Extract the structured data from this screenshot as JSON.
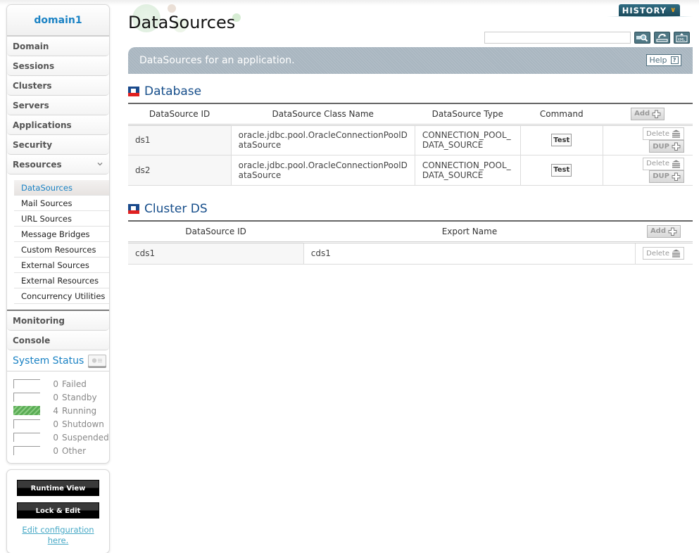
{
  "sidebar": {
    "domain": "domain1",
    "nav": [
      {
        "label": "Domain"
      },
      {
        "label": "Sessions"
      },
      {
        "label": "Clusters"
      },
      {
        "label": "Servers"
      },
      {
        "label": "Applications"
      },
      {
        "label": "Security"
      },
      {
        "label": "Resources",
        "expanded": true
      }
    ],
    "resources_sub": [
      {
        "label": "DataSources",
        "active": true
      },
      {
        "label": "Mail Sources"
      },
      {
        "label": "URL Sources"
      },
      {
        "label": "Message Bridges"
      },
      {
        "label": "Custom Resources"
      },
      {
        "label": "External Sources"
      },
      {
        "label": "External Resources"
      },
      {
        "label": "Concurrency Utilities"
      }
    ],
    "nav_after": [
      {
        "label": "Monitoring"
      },
      {
        "label": "Console"
      }
    ],
    "system_status": {
      "title": "System Status",
      "items": [
        {
          "count": "0",
          "label": "Failed"
        },
        {
          "count": "0",
          "label": "Standby"
        },
        {
          "count": "4",
          "label": "Running"
        },
        {
          "count": "0",
          "label": "Shutdown"
        },
        {
          "count": "0",
          "label": "Suspended"
        },
        {
          "count": "0",
          "label": "Other"
        }
      ],
      "running_color": "#5aad55"
    },
    "actions": {
      "runtime_view": "Runtime View",
      "lock_edit": "Lock & Edit",
      "edit_link_line1": "Edit configuration",
      "edit_link_line2": "here."
    }
  },
  "header": {
    "title": "DataSources",
    "history": "HISTORY",
    "search_value": "",
    "banner_text": "DataSources for an application.",
    "help": "Help",
    "help_q": "?"
  },
  "database": {
    "title": "Database",
    "columns": [
      "DataSource ID",
      "DataSource Class Name",
      "DataSource Type",
      "Command"
    ],
    "add_label": "Add",
    "rows": [
      {
        "id": "ds1",
        "class_line1": "oracle.jdbc.pool.OracleConnectionPoolD",
        "class_line2": "ataSource",
        "type_line1": "CONNECTION_POOL_",
        "type_line2": "DATA_SOURCE",
        "command": "Test",
        "delete": "Delete",
        "dup": "DUP"
      },
      {
        "id": "ds2",
        "class_line1": "oracle.jdbc.pool.OracleConnectionPoolD",
        "class_line2": "ataSource",
        "type_line1": "CONNECTION_POOL_",
        "type_line2": "DATA_SOURCE",
        "command": "Test",
        "delete": "Delete",
        "dup": "DUP"
      }
    ]
  },
  "cluster_ds": {
    "title": "Cluster DS",
    "columns": [
      "DataSource ID",
      "Export Name"
    ],
    "add_label": "Add",
    "rows": [
      {
        "id": "cds1",
        "export_name": "cds1",
        "delete": "Delete"
      }
    ]
  },
  "colors": {
    "accent_blue": "#1a82c4",
    "section_title": "#154d8a",
    "history_bg": "#2f6c82",
    "banner_bg": "#a9b6c0"
  }
}
